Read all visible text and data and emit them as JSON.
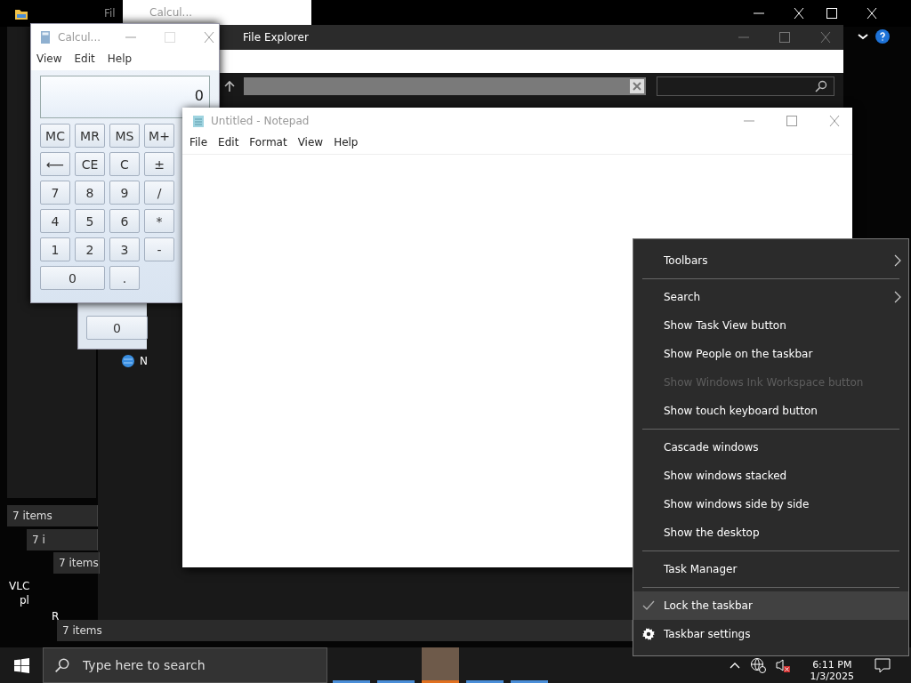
{
  "back_windows": {
    "explorer_title": "Fil",
    "calculator_title": "Calcul...",
    "calculator_key": "0",
    "desktop_icon_label": "N",
    "status_bars": [
      "7 items",
      "7 i",
      "7 items",
      "7 items"
    ],
    "desktop_fragments": [
      "VLC",
      "pl",
      "R"
    ]
  },
  "file_explorer": {
    "title": "File Explorer"
  },
  "calculator": {
    "title": "Calcul...",
    "menu": [
      "View",
      "Edit",
      "Help"
    ],
    "display": "0",
    "keys": [
      {
        "label": "MC",
        "wide": false
      },
      {
        "label": "MR",
        "wide": false
      },
      {
        "label": "MS",
        "wide": false
      },
      {
        "label": "M+",
        "wide": false
      },
      {
        "label": "⟵",
        "wide": false
      },
      {
        "label": "CE",
        "wide": false
      },
      {
        "label": "C",
        "wide": false
      },
      {
        "label": "±",
        "wide": false
      },
      {
        "label": "7",
        "wide": false
      },
      {
        "label": "8",
        "wide": false
      },
      {
        "label": "9",
        "wide": false
      },
      {
        "label": "/",
        "wide": false
      },
      {
        "label": "4",
        "wide": false
      },
      {
        "label": "5",
        "wide": false
      },
      {
        "label": "6",
        "wide": false
      },
      {
        "label": "*",
        "wide": false
      },
      {
        "label": "1",
        "wide": false
      },
      {
        "label": "2",
        "wide": false
      },
      {
        "label": "3",
        "wide": false
      },
      {
        "label": "-",
        "wide": false
      },
      {
        "label": "0",
        "wide": true
      },
      {
        "label": ".",
        "wide": false
      }
    ]
  },
  "notepad": {
    "title": "Untitled - Notepad",
    "menu": [
      "File",
      "Edit",
      "Format",
      "View",
      "Help"
    ]
  },
  "context_menu": {
    "groups": [
      [
        {
          "label": "Toolbars",
          "submenu": true,
          "disabled": false,
          "checked": false,
          "kind": "plain",
          "selected": false
        }
      ],
      [
        {
          "label": "Search",
          "submenu": true,
          "disabled": false,
          "checked": false,
          "kind": "plain",
          "selected": false
        },
        {
          "label": "Show Task View button",
          "submenu": false,
          "disabled": false,
          "checked": false,
          "kind": "plain",
          "selected": false
        },
        {
          "label": "Show People on the taskbar",
          "submenu": false,
          "disabled": false,
          "checked": false,
          "kind": "plain",
          "selected": false
        },
        {
          "label": "Show Windows Ink Workspace button",
          "submenu": false,
          "disabled": true,
          "checked": false,
          "kind": "plain",
          "selected": false
        },
        {
          "label": "Show touch keyboard button",
          "submenu": false,
          "disabled": false,
          "checked": false,
          "kind": "plain",
          "selected": false
        }
      ],
      [
        {
          "label": "Cascade windows",
          "submenu": false,
          "disabled": false,
          "checked": false,
          "kind": "plain",
          "selected": false
        },
        {
          "label": "Show windows stacked",
          "submenu": false,
          "disabled": false,
          "checked": false,
          "kind": "plain",
          "selected": false
        },
        {
          "label": "Show windows side by side",
          "submenu": false,
          "disabled": false,
          "checked": false,
          "kind": "plain",
          "selected": false
        },
        {
          "label": "Show the desktop",
          "submenu": false,
          "disabled": false,
          "checked": false,
          "kind": "plain",
          "selected": false
        }
      ],
      [
        {
          "label": "Task Manager",
          "submenu": false,
          "disabled": false,
          "checked": false,
          "kind": "plain",
          "selected": false
        }
      ],
      [
        {
          "label": "Lock the taskbar",
          "submenu": false,
          "disabled": false,
          "checked": true,
          "kind": "plain",
          "selected": true
        },
        {
          "label": "Taskbar settings",
          "submenu": false,
          "disabled": false,
          "checked": false,
          "kind": "settings",
          "selected": false
        }
      ]
    ]
  },
  "taskbar": {
    "search_placeholder": "Type here to search",
    "time": "6:11 PM",
    "date": "1/3/2025",
    "apps": [
      {
        "selected": false
      },
      {
        "selected": false
      },
      {
        "selected": true
      },
      {
        "selected": false
      },
      {
        "selected": false
      }
    ]
  }
}
